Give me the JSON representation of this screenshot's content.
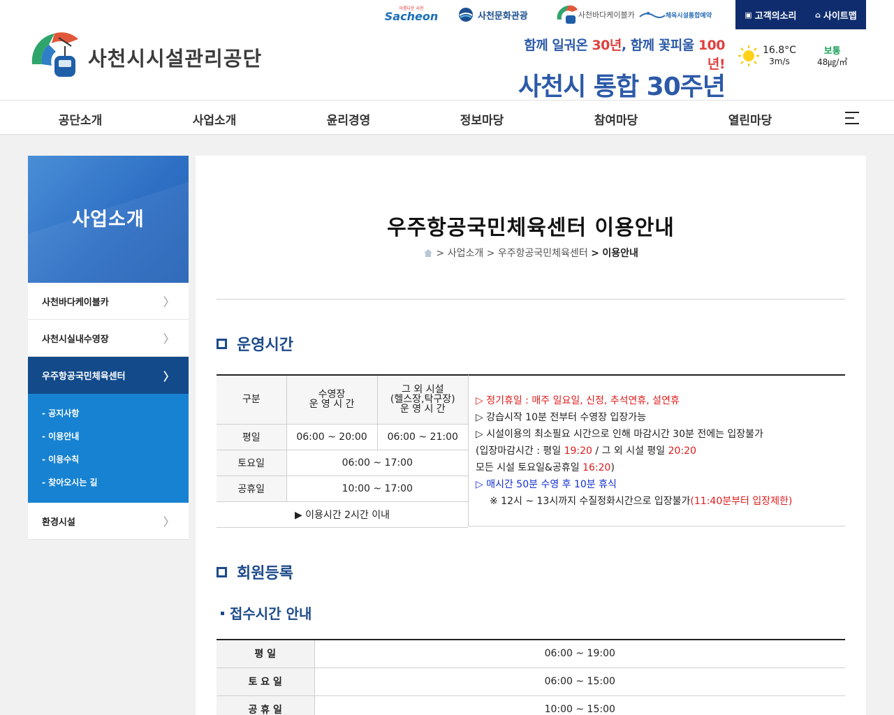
{
  "header": {
    "logo_text": "사천시시설관리공단",
    "top_links": {
      "sacheon_small": "아름다운 사천",
      "sacheon_big": "Sacheon",
      "culture": "사천문화관광",
      "cable": "사천바다케이블카",
      "reserve": "체육시설통합예약"
    },
    "util": {
      "voice": "고객의소리",
      "sitemap": "사이트맵"
    },
    "banner": {
      "line1_a": "함께 일궈온 ",
      "line1_b": "30년",
      "line1_c": ", 함께 꽃피울 ",
      "line1_d": "100년!",
      "line2": "사천시 통합 30주년"
    },
    "weather": {
      "temp": "16.8°C",
      "wind": "3m/s",
      "air_level": "보통",
      "air_value": "48㎍/㎥"
    }
  },
  "nav": [
    "공단소개",
    "사업소개",
    "윤리경영",
    "정보마당",
    "참여마당",
    "열린마당"
  ],
  "sidebar": {
    "title": "사업소개",
    "items": [
      {
        "label": "사천바다케이블카"
      },
      {
        "label": "사천시실내수영장"
      },
      {
        "label": "우주항공국민체육센터"
      },
      {
        "label": "환경시설"
      }
    ],
    "sub_items": [
      "공지사항",
      "이용안내",
      "이용수칙",
      "찾아오시는 길"
    ]
  },
  "content": {
    "title": "우주항공국민체육센터 이용안내",
    "breadcrumb": {
      "sep": ">",
      "b1": "사업소개",
      "b2": "우주항공국민체육센터",
      "b3": "이용안내"
    },
    "section1": "운영시간",
    "table": {
      "h_col0": "구분",
      "h_col1_a": "수영장",
      "h_col1_b": "운 영 시 간",
      "h_col2_a": "그 외 시설",
      "h_col2_b": "(헬스장,탁구장)",
      "h_col2_c": "운 영 시 간",
      "rows": [
        {
          "label": "평일",
          "pool": "06:00 ~ 20:00",
          "other": "06:00 ~ 21:00"
        },
        {
          "label": "토요일",
          "all": "06:00 ~ 17:00"
        },
        {
          "label": "공휴일",
          "all": "10:00 ~ 17:00"
        }
      ],
      "footer": "▶ 이용시간 2시간 이내"
    },
    "notes": {
      "n1": "▷ 정기휴일 : 매주 일요일, 신정, 추석연휴, 설연휴",
      "n2": "▷ 강습시작 10분 전부터 수영장 입장가능",
      "n3": "▷ 시설이용의 최소필요 시간으로 인해 마감시간 30분 전에는 입장불가",
      "n4_a": "(입장마감시간 : 평일 ",
      "n4_b": "19:20",
      "n4_c": " / 그 외 시설 평일 ",
      "n4_d": "20:20",
      "n5_a": "모든 시설 토요일&공휴일 ",
      "n5_b": "16:20",
      "n5_c": ")",
      "n6": "▷ 매시간 50분 수영 후 10분 휴식",
      "n7_a": "※ 12시 ~ 13시까지 수질정화시간으로 입장불가",
      "n7_b": "(11:40분부터 입장제한)"
    },
    "section2": "회원등록",
    "subsection": "접수시간 안내",
    "reception": [
      {
        "label": "평 일",
        "time": "06:00 ~ 19:00"
      },
      {
        "label": "토 요 일",
        "time": "06:00 ~ 15:00"
      },
      {
        "label": "공 휴 일",
        "time": "10:00 ~ 15:00"
      }
    ]
  },
  "colors": {
    "primary": "#124a8a",
    "accent": "#1782d1",
    "red": "#e01b1b",
    "blue": "#1330d0"
  }
}
